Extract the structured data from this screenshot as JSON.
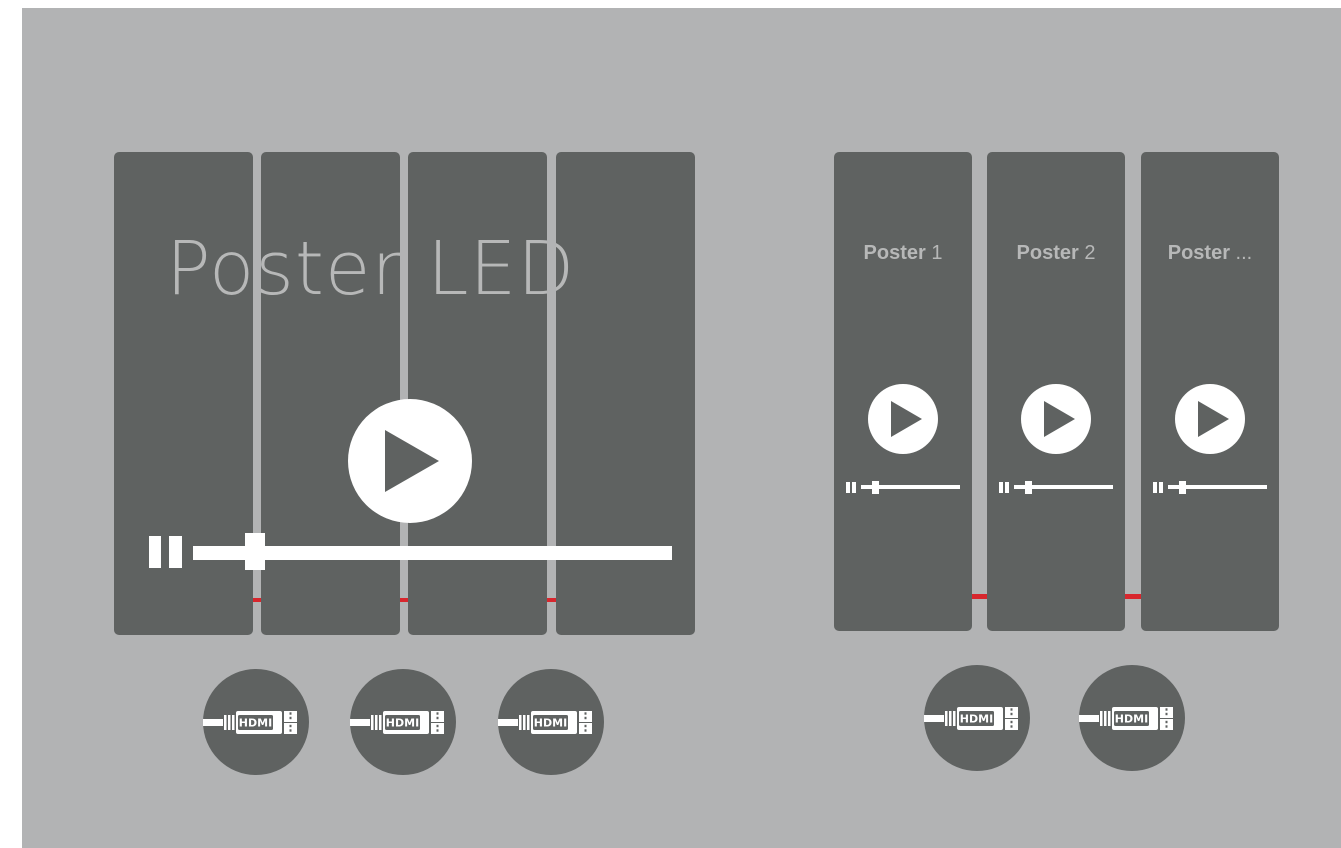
{
  "led_wall": {
    "title": "Poster LED"
  },
  "posters": [
    {
      "name_bold": "Poster",
      "name_suffix": " 1"
    },
    {
      "name_bold": "Poster",
      "name_suffix": " 2"
    },
    {
      "name_bold": "Poster",
      "name_suffix": "  ..."
    }
  ],
  "hdmi_label": "HDMI",
  "colors": {
    "background": "#b2b3b4",
    "panel": "#5f6261",
    "connector": "#d8262d",
    "control": "#ffffff"
  }
}
